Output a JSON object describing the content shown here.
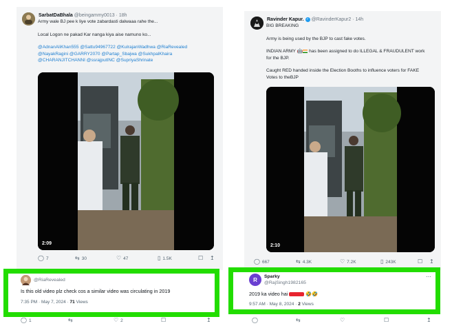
{
  "left_tweet": {
    "author_name": "SarbatDaBhala",
    "author_handle": "@beingammy0013 · 18h",
    "line1": "Army wale BJ pee k liye vote zabardasti dalwaaa rahe the...",
    "line2": "Local Logon ne pakad Kar nanga kiya aise namuno ko...",
    "mentions_1": "@AdnanAliKhan555 @Sattu94967722 @KulrajanWadhwa @RiaRevealed",
    "mentions_2": "@NayakRagini @GARRY2070 @Partap_Sbajwa @SukhpalKhaira",
    "mentions_3": "@CHARANJITCHANNI @ssrajputINC @SupriyaShrinate",
    "video_duration": "2:09",
    "reply_count": "7",
    "retweet_count": "30",
    "like_count": "47",
    "view_count": "1.5K"
  },
  "left_reply": {
    "author_handle": "@RiaRevealed",
    "text": "Is this old video plz check cos a similar video was circulating in 2019",
    "time": "7:35 PM · May 7, 2024 · ",
    "views_count": "71",
    "views_label": " Views",
    "reply_count": "1",
    "like_count": "2"
  },
  "right_tweet": {
    "author_name": "Ravinder Kapur.",
    "author_handle": "@RavinderKapur2 · 14h",
    "line1": "BIG BREAKING",
    "line2": "Army is being used by the BJP to cast fake votes.",
    "line3a": "INDIAN ARMY",
    "line3b": "has been assigned to do ILLEGAL & FRAUDULENT work",
    "line4": "for the BJP.",
    "line5": "Caught RED handed inside the Election Booths to influence voters for FAKE",
    "line6": "Votes to theBJP",
    "video_duration": "2:10",
    "reply_count": "667",
    "retweet_count": "4.3K",
    "like_count": "7.2K",
    "view_count": "243K"
  },
  "right_reply": {
    "author_name": "Sparky",
    "author_handle": "@RajSingh1982165",
    "avatar_letter": "R",
    "text_before": "2019 ka video hai",
    "text_after": "🤣🤣",
    "time": "9:57 AM · May 8, 2024 · ",
    "views_count": "2",
    "views_label": " Views"
  },
  "colors": {
    "highlight": "#22dd00",
    "link": "#1d7ed0",
    "secondary_text": "#536471",
    "right_reply_avatar": "#6a3fd1"
  },
  "icons": [
    "reply-icon",
    "retweet-icon",
    "like-icon",
    "views-icon",
    "bookmark-icon",
    "share-icon",
    "more-icon",
    "verified-icon"
  ]
}
